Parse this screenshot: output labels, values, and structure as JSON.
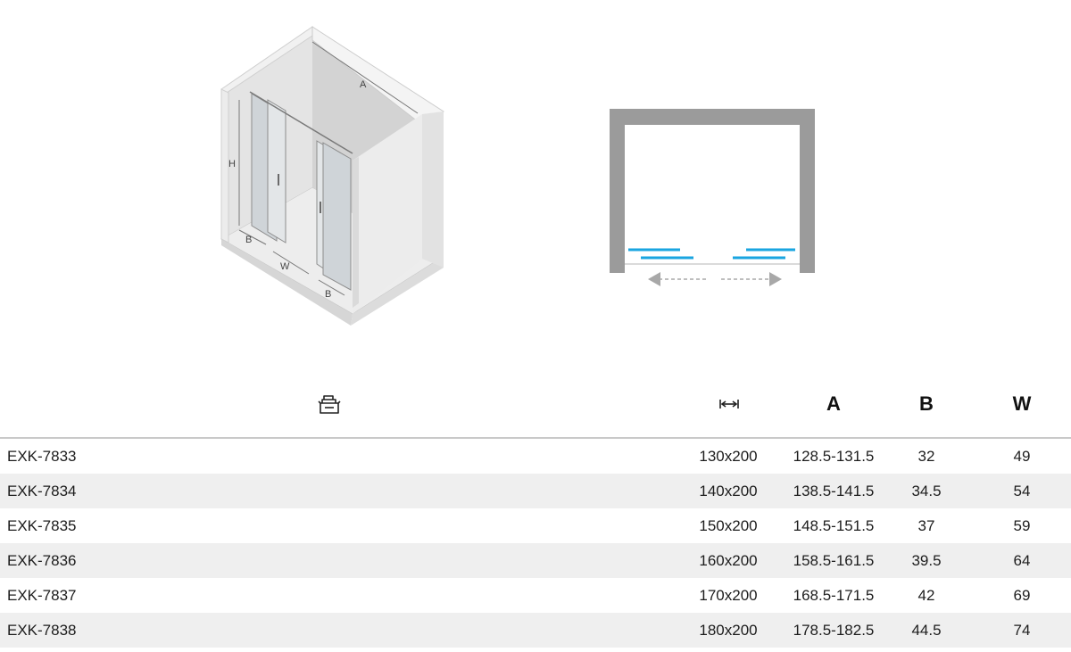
{
  "isometric_diagram": {
    "labels": {
      "a": "A",
      "h": "H",
      "w": "W",
      "b_left": "B",
      "b_right": "B"
    }
  },
  "plan_diagram": {
    "frame_color": "#9b9b9b",
    "glass_color": "#1aa5e0",
    "arrow_color": "#a8a8a8"
  },
  "table": {
    "headers": {
      "product_icon": "box-stack-icon",
      "size_icon": "width-arrows-icon",
      "a": "A",
      "b": "B",
      "w": "W"
    },
    "rows": [
      {
        "code": "EXK-7833",
        "size": "130x200",
        "a": "128.5-131.5",
        "b": "32",
        "w": "49"
      },
      {
        "code": "EXK-7834",
        "size": "140x200",
        "a": "138.5-141.5",
        "b": "34.5",
        "w": "54"
      },
      {
        "code": "EXK-7835",
        "size": "150x200",
        "a": "148.5-151.5",
        "b": "37",
        "w": "59"
      },
      {
        "code": "EXK-7836",
        "size": "160x200",
        "a": "158.5-161.5",
        "b": "39.5",
        "w": "64"
      },
      {
        "code": "EXK-7837",
        "size": "170x200",
        "a": "168.5-171.5",
        "b": "42",
        "w": "69"
      },
      {
        "code": "EXK-7838",
        "size": "180x200",
        "a": "178.5-182.5",
        "b": "44.5",
        "w": "74"
      }
    ]
  }
}
